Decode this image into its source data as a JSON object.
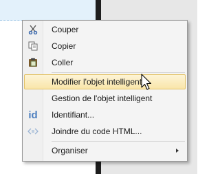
{
  "menu": {
    "items": [
      {
        "label": "Couper",
        "icon": "scissors-icon"
      },
      {
        "label": "Copier",
        "icon": "copy-icon"
      },
      {
        "label": "Coller",
        "icon": "paste-icon"
      },
      {
        "label": "Modifier l'objet intelligent",
        "icon": "",
        "highlighted": true
      },
      {
        "label": "Gestion de l'objet intelligent",
        "icon": ""
      },
      {
        "label": "Identifiant...",
        "icon": "id-icon",
        "icon_text": "id"
      },
      {
        "label": "Joindre du code HTML...",
        "icon": "html-code-icon"
      },
      {
        "label": "Organiser",
        "icon": "",
        "submenu": true
      }
    ]
  },
  "colors": {
    "highlight": "#f9e5a9",
    "highlight_border": "#e3c266",
    "id_icon": "#4d7fbf"
  }
}
